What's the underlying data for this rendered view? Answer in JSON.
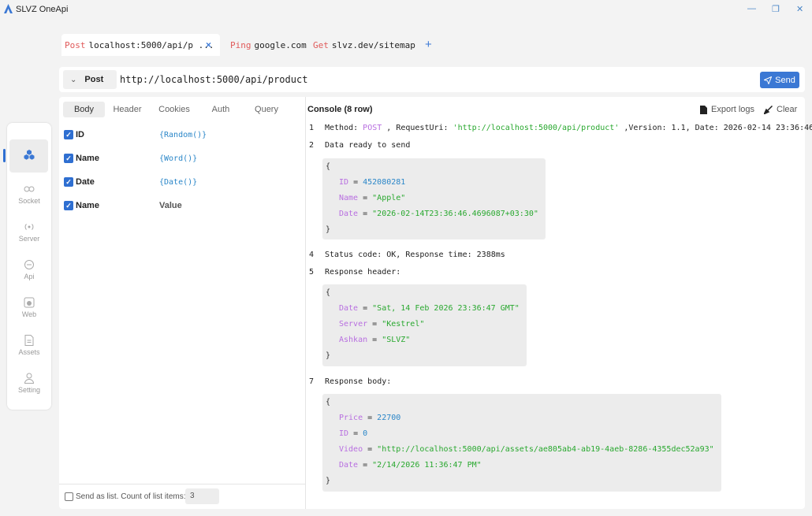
{
  "app": {
    "title": "SLVZ OneApi"
  },
  "tabs": [
    {
      "method": "Post",
      "url": "localhost:5000/api/p ...",
      "close": "×"
    },
    {
      "method": "Ping",
      "url": "google.com"
    },
    {
      "method": "Get",
      "url": "slvz.dev/sitemap"
    }
  ],
  "add_tab": "+",
  "request": {
    "method": "Post",
    "url": "http://localhost:5000/api/product",
    "send_label": "Send"
  },
  "subtabs": [
    "Body",
    "Header",
    "Cookies",
    "Auth",
    "Query"
  ],
  "params": [
    {
      "name": "ID",
      "value": "{Random()}",
      "checked": true
    },
    {
      "name": "Name",
      "value": "{Word()}",
      "checked": true
    },
    {
      "name": "Date",
      "value": "{Date()}",
      "checked": true
    },
    {
      "name": "Name",
      "value": "Value",
      "checked": true,
      "placeholder": true
    }
  ],
  "send_list": {
    "label": "Send as list. Count of list items:",
    "count": "3"
  },
  "console": {
    "title": "Console (8 row)",
    "export_label": "Export logs",
    "clear_label": "Clear",
    "lines": {
      "l1": {
        "num": "1",
        "prefix": "Method: ",
        "method": "POST",
        "mid": " , RequestUri: ",
        "uri": "'http://localhost:5000/api/product'",
        "suffix": " ,Version: 1.1, Date: 2026-02-14 23:36:46"
      },
      "l2": {
        "num": "2",
        "text": "Data ready to send"
      },
      "l4": {
        "num": "4",
        "text": "Status code: OK, Response time: 2388ms"
      },
      "l5": {
        "num": "5",
        "text": "Response header:"
      },
      "l7": {
        "num": "7",
        "text": "Response body:"
      }
    },
    "data_block": [
      {
        "key": "ID",
        "value": "452080281",
        "type": "number"
      },
      {
        "key": "Name",
        "value": "\"Apple\"",
        "type": "string"
      },
      {
        "key": "Date",
        "value": "\"2026-02-14T23:36:46.4696087+03:30\"",
        "type": "string"
      }
    ],
    "header_block": [
      {
        "key": "Date",
        "value": "\"Sat, 14 Feb 2026 23:36:47 GMT\"",
        "type": "string"
      },
      {
        "key": "Server",
        "value": "\"Kestrel\"",
        "type": "string"
      },
      {
        "key": "Ashkan",
        "value": "\"SLVZ\"",
        "type": "string"
      }
    ],
    "body_block": [
      {
        "key": "Price",
        "value": "22700",
        "type": "number"
      },
      {
        "key": "ID",
        "value": "0",
        "type": "number"
      },
      {
        "key": "Video",
        "value": "\"http://localhost:5000/api/assets/ae805ab4-ab19-4aeb-8286-4355dec52a93\"",
        "type": "string"
      },
      {
        "key": "Date",
        "value": "\"2/14/2026 11:36:47 PM\"",
        "type": "string"
      }
    ],
    "open_brace": "{",
    "close_brace": "}",
    "eq": " = "
  },
  "nav": [
    {
      "label": "",
      "icon": "cubes-icon",
      "active": true
    },
    {
      "label": "Socket",
      "icon": "socket-icon"
    },
    {
      "label": "Server",
      "icon": "broadcast-icon"
    },
    {
      "label": "Api",
      "icon": "api-icon"
    },
    {
      "label": "Web",
      "icon": "web-icon"
    },
    {
      "label": "Assets",
      "icon": "document-icon"
    },
    {
      "label": "Setting",
      "icon": "user-icon"
    }
  ],
  "colors": {
    "accent": "#3b78d4",
    "method_tab": "#e05a5a",
    "keyword": "#b86fe0",
    "string": "#29a82f",
    "number": "#2a86c8"
  }
}
